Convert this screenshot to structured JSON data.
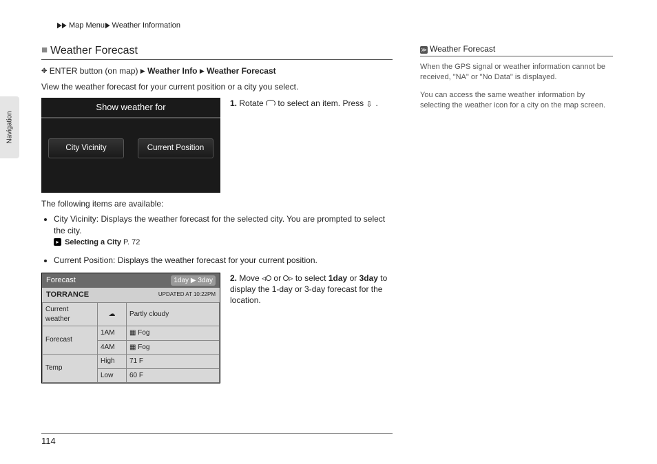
{
  "breadcrumb": {
    "sep": "▶",
    "item1": "Map Menu",
    "item2": "Weather Information"
  },
  "vertTab": "Navigation",
  "section": {
    "title": "Weather Forecast",
    "pathPrefix": "ENTER button (on map)",
    "path1": "Weather Info",
    "path2": "Weather Forecast",
    "intro": "View the weather forecast for your current position or a city you select."
  },
  "screen1": {
    "title": "Show weather for",
    "opt1": "City Vicinity",
    "opt2": "Current Position"
  },
  "step1": {
    "num": "1.",
    "a": "Rotate",
    "b": "to select an item. Press",
    "c": "."
  },
  "available": "The following items are available:",
  "bullets": {
    "b1label": "City Vicinity",
    "b1text": ": Displays the weather forecast for the selected city. You are prompted to select the city.",
    "b1refTitle": "Selecting a City",
    "b1refPage": "P. 72",
    "b2label": "Current Position",
    "b2text": ": Displays the weather forecast for your current position."
  },
  "screen2": {
    "headerTitle": "Forecast",
    "tab1": "1day",
    "tab2": "3day",
    "city": "TORRANCE",
    "updated": "UPDATED AT 10:22PM",
    "rowCW": "Current weather",
    "valCW": "Partly cloudy",
    "rowFc": "Forecast",
    "fc1t": "1AM",
    "fc1v": "Fog",
    "fc2t": "4AM",
    "fc2v": "Fog",
    "rowTemp": "Temp",
    "tHigh": "High",
    "tHighV": "71 F",
    "tLow": "Low",
    "tLowV": "60 F"
  },
  "step2": {
    "num": "2.",
    "a": "Move",
    "b": "or",
    "c": "to select",
    "d1": "1day",
    "e": "or",
    "d2": "3day",
    "f": "to display the 1-day or 3-day forecast for the location."
  },
  "side": {
    "title": "Weather Forecast",
    "p1": "When the GPS signal or weather information cannot be received, \"NA\" or \"No Data\" is displayed.",
    "p2": "You can access the same weather information by selecting the weather icon for a city on the map screen."
  },
  "pagenum": "114"
}
